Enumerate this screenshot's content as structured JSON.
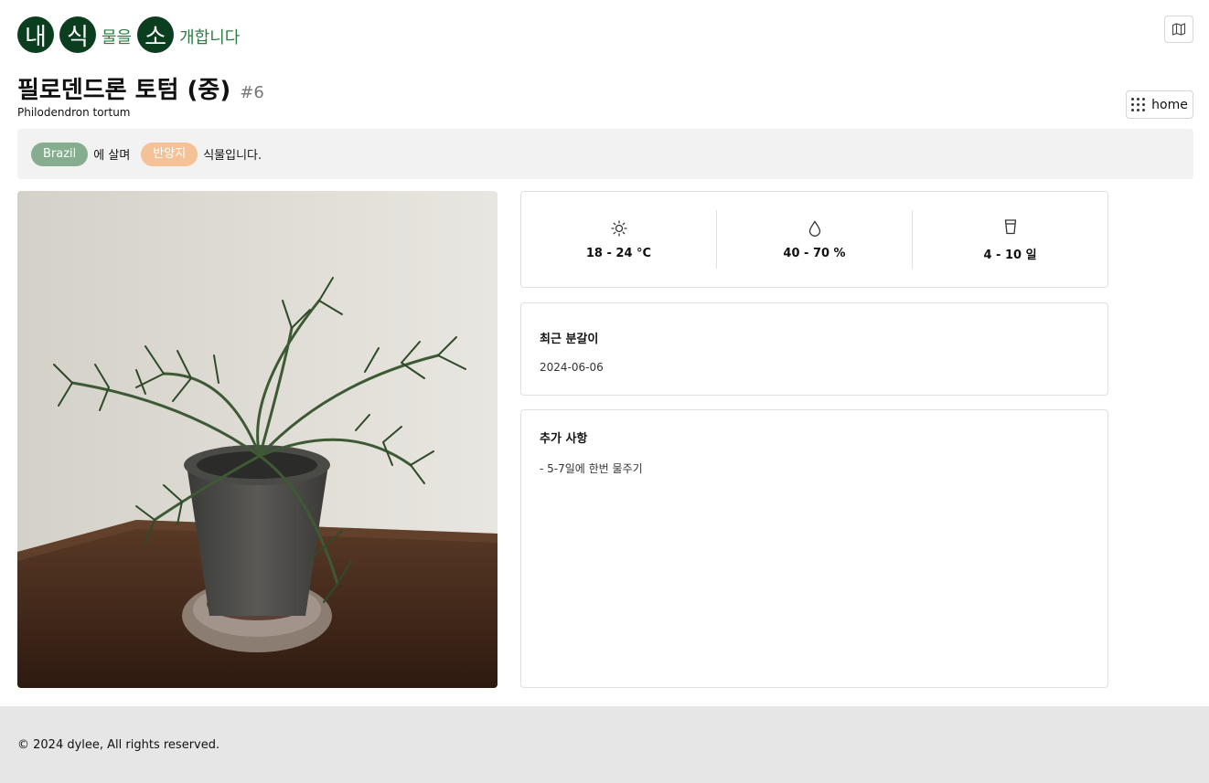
{
  "logo": {
    "char1": "내",
    "char2": "식",
    "small1": "물을",
    "char3": "소",
    "small2": "개합니다"
  },
  "plant": {
    "name": "필로덴드론 토텀 (중)",
    "number": "#6",
    "scientific_name": "Philodendron tortum"
  },
  "nav": {
    "home_label": "home"
  },
  "info": {
    "origin": "Brazil",
    "origin_suffix": "에 살며",
    "light": "반양지",
    "light_suffix": "식물입니다."
  },
  "care": {
    "temperature": "18 - 24 °C",
    "humidity": "40 - 70 %",
    "watering": "4 - 10 일"
  },
  "repot": {
    "title": "최근 분갈이",
    "date": "2024-06-06"
  },
  "notes": {
    "title": "추가 사항",
    "body": "- 5-7일에 한번 물주기"
  },
  "footer": {
    "copyright": "© 2024 dylee, All rights reserved."
  },
  "colors": {
    "logo_dark": "#0b3d1f",
    "logo_text": "#2e7d45",
    "origin_pill": "#86ad8f",
    "light_pill": "#f5c197"
  }
}
